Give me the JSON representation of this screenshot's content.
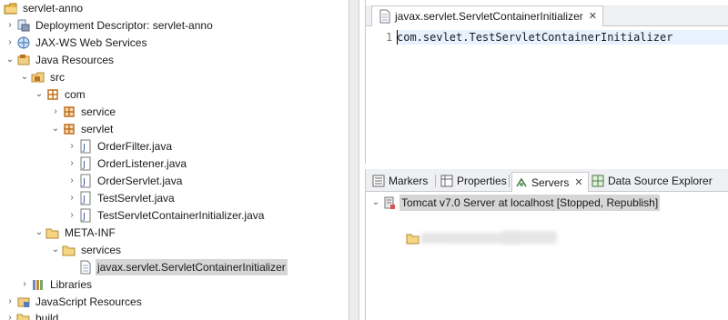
{
  "explorer": {
    "rows": [
      {
        "label": "servlet-anno",
        "icon": "project-icon"
      },
      {
        "label": "Deployment Descriptor: servlet-anno",
        "icon": "deployment-descriptor-icon"
      },
      {
        "label": "JAX-WS Web Services",
        "icon": "web-services-icon"
      },
      {
        "label": "Java Resources",
        "icon": "java-resources-icon"
      },
      {
        "label": "src",
        "icon": "source-folder-icon"
      },
      {
        "label": "com",
        "icon": "package-icon"
      },
      {
        "label": "service",
        "icon": "package-icon"
      },
      {
        "label": "servlet",
        "icon": "package-icon"
      },
      {
        "label": "OrderFilter.java",
        "icon": "java-file-icon"
      },
      {
        "label": "OrderListener.java",
        "icon": "java-file-icon"
      },
      {
        "label": "OrderServlet.java",
        "icon": "java-file-icon"
      },
      {
        "label": "TestServlet.java",
        "icon": "java-file-icon"
      },
      {
        "label": "TestServletContainerInitializer.java",
        "icon": "java-file-icon"
      },
      {
        "label": "META-INF",
        "icon": "folder-icon"
      },
      {
        "label": "services",
        "icon": "folder-icon"
      },
      {
        "label": "javax.servlet.ServletContainerInitializer",
        "icon": "file-icon"
      },
      {
        "label": "Libraries",
        "icon": "libraries-icon"
      },
      {
        "label": "JavaScript Resources",
        "icon": "javascript-resources-icon"
      },
      {
        "label": "build",
        "icon": "folder-icon"
      }
    ]
  },
  "editor": {
    "tab_title": "javax.servlet.ServletContainerInitializer",
    "line_number": "1",
    "code_line": "com.sevlet.TestServletContainerInitializer"
  },
  "views": {
    "tabs": [
      "Markers",
      "Properties",
      "Servers",
      "Data Source Explorer"
    ],
    "active_tab": "Servers",
    "server_label": "Tomcat v7.0 Server at localhost  [Stopped, Republish]",
    "module_label_fragment": "ron."
  },
  "colors": {
    "selection": "#d6d6d6",
    "current_line": "#e8f2fe",
    "package_orange": "#c0701e",
    "folder_yellow": "#e8b84a"
  }
}
